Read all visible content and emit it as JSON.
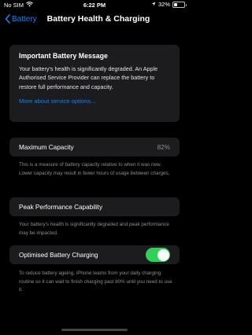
{
  "status_bar": {
    "carrier": "No SIM",
    "time": "6:22 PM",
    "battery_percent": "32%",
    "battery_level": 0.32
  },
  "nav": {
    "back_label": "Battery",
    "title": "Battery Health & Charging"
  },
  "message": {
    "title": "Important Battery Message",
    "body": "Your battery's health is significantly degraded. An Apple Authorised Service Provider can replace the battery to restore full performance and capacity.",
    "link": "More about service options..."
  },
  "max_capacity": {
    "label": "Maximum Capacity",
    "value": "82%",
    "note": "This is a measure of battery capacity relative to when it was new. Lower capacity may result in fewer hours of usage between charges."
  },
  "peak_performance": {
    "label": "Peak Performance Capability",
    "note": "Your battery's health is significantly degraded and peak performance may be impacted."
  },
  "optimised_charging": {
    "label": "Optimised Battery Charging",
    "enabled": true,
    "note": "To reduce battery ageing, iPhone learns from your daily charging routine so it can wait to finish charging past 80% until you need to use it."
  },
  "colors": {
    "accent": "#0a84ff",
    "toggle_on": "#30d158",
    "card_bg": "#1c1c1e"
  }
}
